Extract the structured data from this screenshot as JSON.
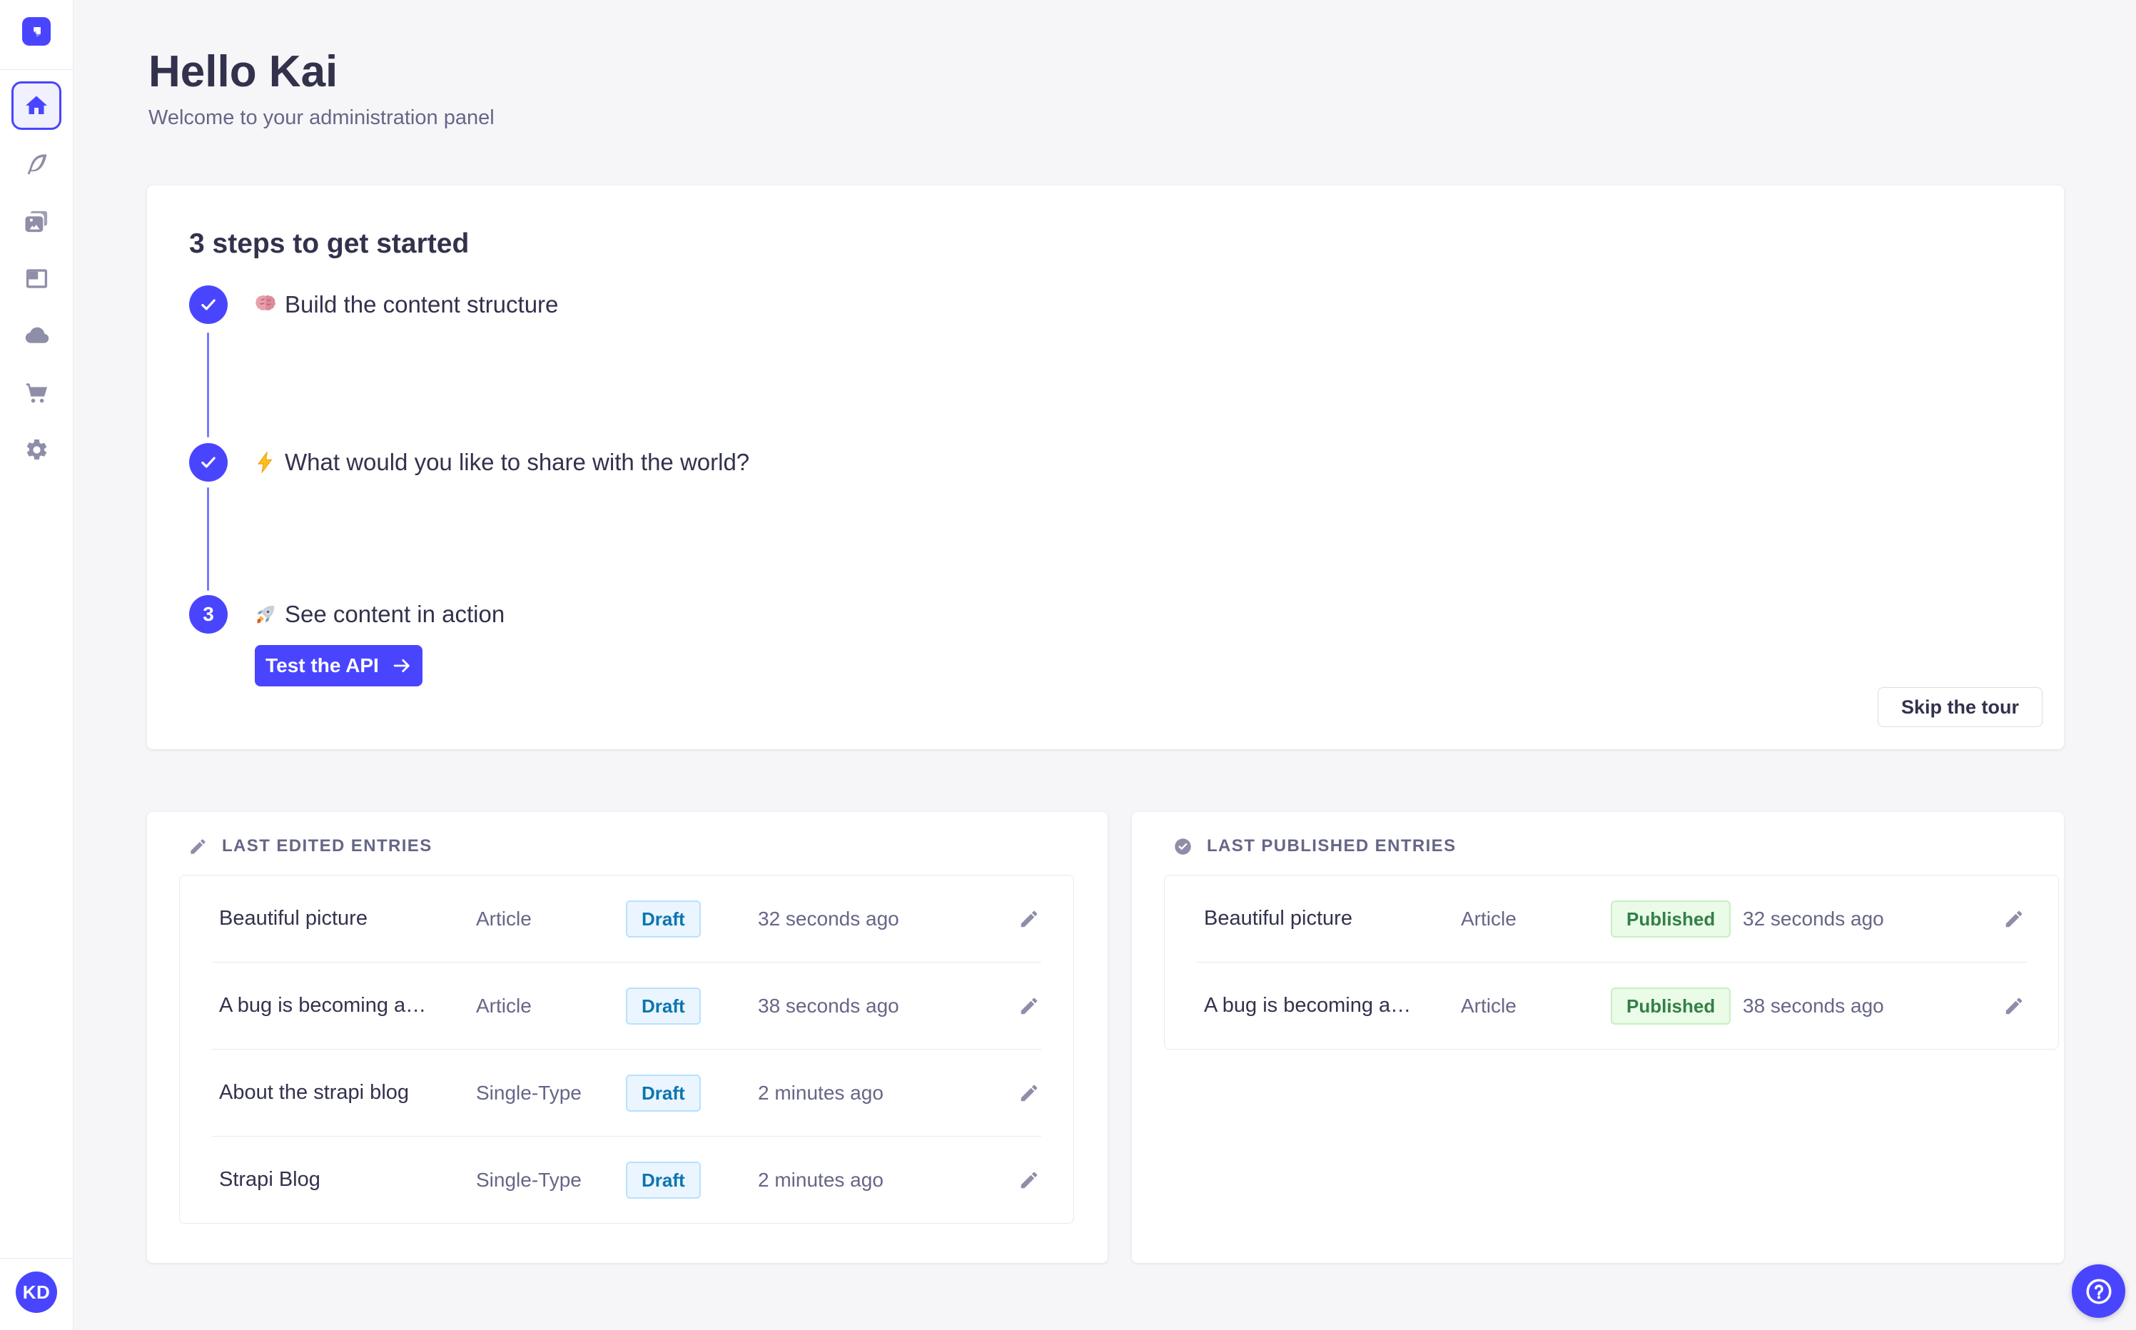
{
  "colors": {
    "primary": "#4945FF",
    "primary_light": "#F0F0FF",
    "connector": "#7B79FF",
    "background": "#F6F6F9",
    "text_dark": "#32324D",
    "text_muted": "#666687",
    "icon_gray": "#8E8EA9",
    "border": "#EAEAEF",
    "draft_bg": "#EAF5FF",
    "draft_text": "#0C75AF",
    "published_bg": "#EAFBE7",
    "published_text": "#328048"
  },
  "sidebar": {
    "icons": [
      "strapi-logo",
      "home",
      "content-manager",
      "media-library",
      "content-type-builder",
      "cloud",
      "marketplace",
      "settings"
    ],
    "active_item": "home",
    "avatar_initials": "KD"
  },
  "header": {
    "title": "Hello Kai",
    "subtitle": "Welcome to your administration panel"
  },
  "onboarding": {
    "title": "3 steps to get started",
    "steps": [
      {
        "status": "completed",
        "emoji": "🧠",
        "emoji_name": "brain",
        "label": "Build the content structure"
      },
      {
        "status": "completed",
        "emoji": "⚡",
        "emoji_name": "zap",
        "label": "What would you like to share with the world?"
      },
      {
        "status": "current",
        "step_number": "3",
        "emoji": "🚀",
        "emoji_name": "rocket",
        "label": "See content in action"
      }
    ],
    "cta_label": "Test the API",
    "skip_label": "Skip the tour"
  },
  "last_edited": {
    "title": "LAST EDITED ENTRIES",
    "rows": [
      {
        "title": "Beautiful picture",
        "kind": "Article",
        "status": "Draft",
        "time": "32 seconds ago"
      },
      {
        "title": "A bug is becoming a…",
        "kind": "Article",
        "status": "Draft",
        "time": "38 seconds ago"
      },
      {
        "title": "About the strapi blog",
        "kind": "Single-Type",
        "status": "Draft",
        "time": "2 minutes ago"
      },
      {
        "title": "Strapi Blog",
        "kind": "Single-Type",
        "status": "Draft",
        "time": "2 minutes ago"
      }
    ]
  },
  "last_published": {
    "title": "LAST PUBLISHED ENTRIES",
    "rows": [
      {
        "title": "Beautiful picture",
        "kind": "Article",
        "status": "Published",
        "time": "32 seconds ago"
      },
      {
        "title": "A bug is becoming a…",
        "kind": "Article",
        "status": "Published",
        "time": "38 seconds ago"
      }
    ]
  }
}
